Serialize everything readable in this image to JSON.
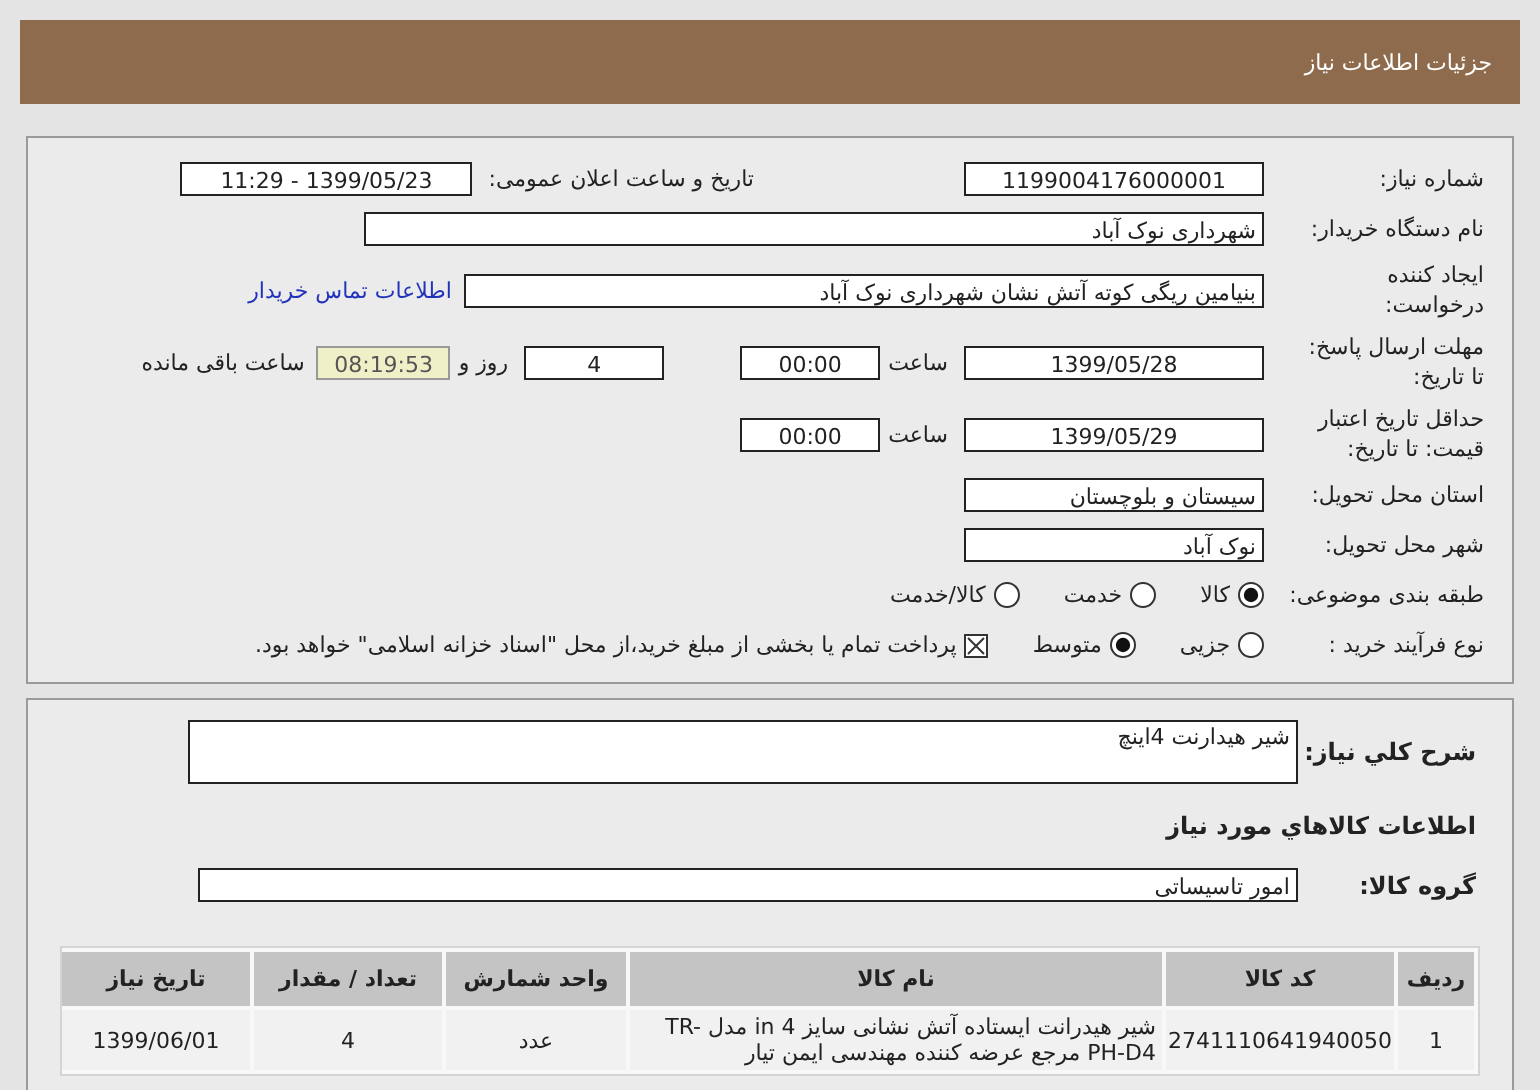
{
  "header": {
    "title": "جزئیات اطلاعات نیاز"
  },
  "details": {
    "need_number": {
      "label": "شماره نیاز:",
      "value": "1199004176000001"
    },
    "announce": {
      "label": "تاریخ و ساعت اعلان عمومی:",
      "value": "1399/05/23 - 11:29"
    },
    "buyer": {
      "label": "نام دستگاه خریدار:",
      "value": "شهرداری نوک آباد"
    },
    "creator": {
      "label_lines": [
        "ایجاد کننده",
        "درخواست:"
      ],
      "value": "بنیامین  ریگی کوته  آتش نشان شهرداری نوک آباد",
      "link": "اطلاعات تماس خریدار"
    },
    "deadline": {
      "label_lines": [
        "مهلت ارسال پاسخ:",
        "تا تاریخ:"
      ],
      "date": "1399/05/28",
      "time_label": "ساعت",
      "time": "00:00",
      "days": "4",
      "days_label": "روز و",
      "remaining": "08:19:53",
      "remaining_label": "ساعت باقی مانده"
    },
    "validity": {
      "label_lines": [
        "حداقل تاریخ اعتبار",
        "قیمت: تا تاریخ:"
      ],
      "date": "1399/05/29",
      "time_label": "ساعت",
      "time": "00:00"
    },
    "province": {
      "label": "استان محل تحویل:",
      "value": "سیستان و بلوچستان"
    },
    "city": {
      "label": "شهر محل تحویل:",
      "value": "نوک آباد"
    },
    "category": {
      "label": "طبقه بندی موضوعی:",
      "options": [
        {
          "label": "کالا",
          "selected": true
        },
        {
          "label": "خدمت",
          "selected": false
        },
        {
          "label": "کالا/خدمت",
          "selected": false
        }
      ]
    },
    "process": {
      "label": "نوع فرآیند خرید :",
      "options": [
        {
          "label": "جزیی",
          "selected": false
        },
        {
          "label": "متوسط",
          "selected": true
        }
      ],
      "treasury": {
        "checked": true,
        "label": "پرداخت تمام یا بخشی از مبلغ خرید،از محل \"اسناد خزانه اسلامی\" خواهد بود."
      }
    }
  },
  "summary": {
    "description_label": "شرح کلي نیاز:",
    "description": "شیر هیدارنت 4اینچ",
    "goods_title": "اطلاعات کالاهاي مورد نیاز",
    "group_label": "گروه کالا:",
    "group": "امور تاسیساتی",
    "table": {
      "columns": [
        "ردیف",
        "کد کالا",
        "نام کالا",
        "واحد شمارش",
        "تعداد / مقدار",
        "تاریخ نیاز"
      ],
      "rows": [
        [
          "1",
          "2741110641940050",
          "شیر هیدرانت ایستاده آتش نشانی سایز 4 in مدل TR-PH-D4 مرجع عرضه کننده مهندسی ایمن تیار",
          "عدد",
          "4",
          "1399/06/01"
        ]
      ]
    }
  }
}
